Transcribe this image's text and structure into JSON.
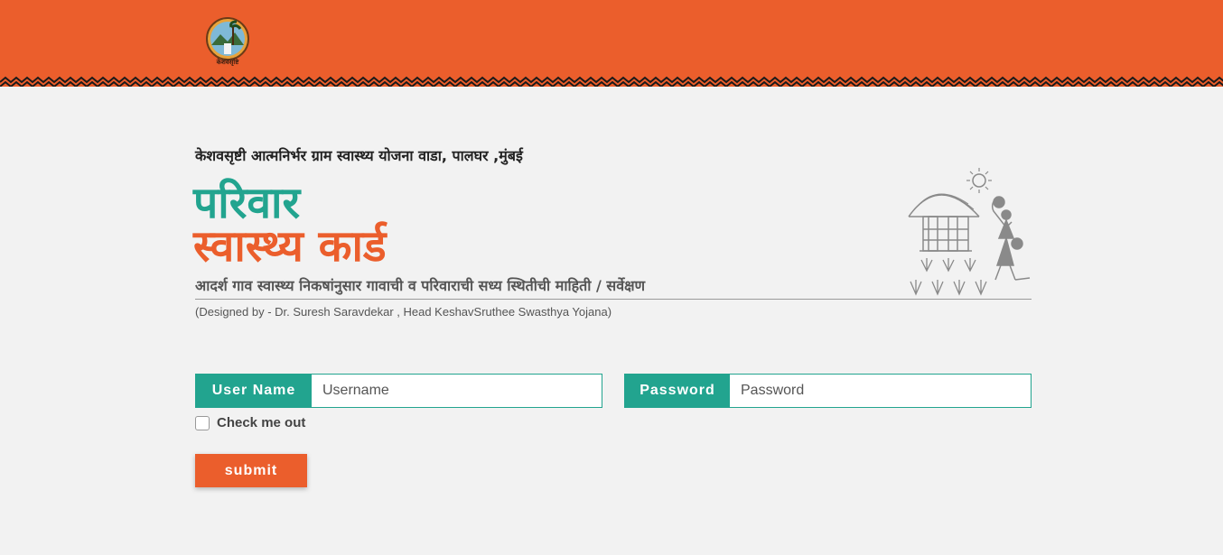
{
  "header": {
    "logo_text": "केशवसृष्टि",
    "background_color": "#eb5e2c"
  },
  "hero": {
    "org_title": "केशवसृष्टी आत्मनिर्भर ग्राम स्वास्थ्य योजना वाडा, पालघर ,मुंबई",
    "title_line1": "परिवार",
    "title_line2": "स्वास्थ्य कार्ड",
    "subtitle": "आदर्श गाव स्वास्थ्य निकषांनुसार गावाची व परिवाराची सध्य स्थितीची माहिती / सर्वेक्षण",
    "designed_by": "(Designed by - Dr. Suresh Saravdekar , Head KeshavSruthee Swasthya Yojana)",
    "accent_teal": "#22a48f",
    "accent_orange": "#eb5e2c"
  },
  "form": {
    "username_label": "User Name",
    "username_placeholder": "Username",
    "username_value": "",
    "password_label": "Password",
    "password_placeholder": "Password",
    "password_value": "",
    "check_label": "Check me out",
    "submit_label": "submit"
  }
}
